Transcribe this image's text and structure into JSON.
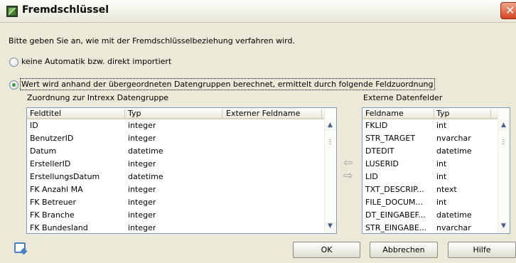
{
  "window": {
    "title": "Fremdschlüssel"
  },
  "instruction": "Bitte geben Sie an, wie mit der Fremdschlüsselbeziehung verfahren wird.",
  "options": [
    {
      "label": "keine Automatik bzw. direkt importiert",
      "checked": false
    },
    {
      "label": "Wert wird anhand der übergeordneten Datengruppen berechnet, ermittelt durch folgende Feldzuordnung",
      "checked": true
    }
  ],
  "left_list": {
    "label": "Zuordnung zur Intrexx Datengruppe",
    "columns": [
      "Feldtitel",
      "Typ",
      "Externer Feldname"
    ],
    "rows": [
      [
        "ID",
        "integer",
        ""
      ],
      [
        "BenutzerID",
        "integer",
        ""
      ],
      [
        "Datum",
        "datetime",
        ""
      ],
      [
        "ErstellerID",
        "integer",
        ""
      ],
      [
        "ErstellungsDatum",
        "datetime",
        ""
      ],
      [
        "FK Anzahl MA",
        "integer",
        ""
      ],
      [
        "FK Betreuer",
        "integer",
        ""
      ],
      [
        "FK Branche",
        "integer",
        ""
      ],
      [
        "FK Bundesland",
        "integer",
        ""
      ]
    ]
  },
  "right_list": {
    "label": "Externe Datenfelder",
    "columns": [
      "Feldname",
      "Typ"
    ],
    "rows": [
      [
        "FKLID",
        "int"
      ],
      [
        "STR_TARGET",
        "nvarchar"
      ],
      [
        "DTEDIT",
        "datetime"
      ],
      [
        "LUSERID",
        "int"
      ],
      [
        "LID",
        "int"
      ],
      [
        "TXT_DESCRIP...",
        "ntext"
      ],
      [
        "FILE_DOCUM...",
        "int"
      ],
      [
        "DT_EINGABEF...",
        "datetime"
      ],
      [
        "STR_EINGABE...",
        "nvarchar"
      ]
    ]
  },
  "icons": {
    "app": "app-icon",
    "close": "close-icon",
    "arrow_left": "arrow-left-icon",
    "arrow_right": "arrow-right-icon",
    "help": "help-icon"
  },
  "buttons": {
    "ok": "OK",
    "cancel": "Abbrechen",
    "help": "Hilfe"
  },
  "colors": {
    "close_button": "#d2451f",
    "radio_dot": "#3d9a3d",
    "list_border": "#7f9db9"
  }
}
